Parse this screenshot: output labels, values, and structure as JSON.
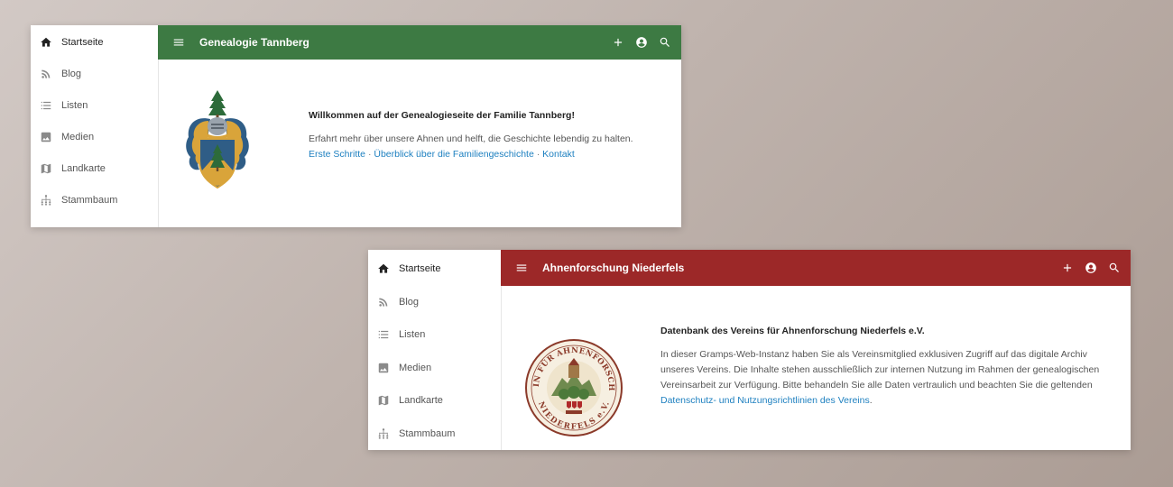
{
  "window1": {
    "accent_color": "#3d7a43",
    "title": "Genealogie Tannberg",
    "nav": [
      {
        "label": "Startseite",
        "icon": "home-icon"
      },
      {
        "label": "Blog",
        "icon": "rss-icon"
      },
      {
        "label": "Listen",
        "icon": "list-icon"
      },
      {
        "label": "Medien",
        "icon": "image-icon"
      },
      {
        "label": "Landkarte",
        "icon": "map-icon"
      },
      {
        "label": "Stammbaum",
        "icon": "family-tree-icon"
      }
    ],
    "heading": "Willkommen auf der Genealogieseite der Familie Tannberg!",
    "paragraph": "Erfahrt mehr über unsere Ahnen und helft, die Geschichte lebendig zu halten.",
    "links": [
      "Erste Schritte",
      "Überblick über die Familiengeschichte",
      "Kontakt"
    ],
    "link_separator": " · "
  },
  "window2": {
    "accent_color": "#9c2828",
    "title": "Ahnenforschung Niederfels",
    "nav": [
      {
        "label": "Startseite",
        "icon": "home-icon"
      },
      {
        "label": "Blog",
        "icon": "rss-icon"
      },
      {
        "label": "Listen",
        "icon": "list-icon"
      },
      {
        "label": "Medien",
        "icon": "image-icon"
      },
      {
        "label": "Landkarte",
        "icon": "map-icon"
      },
      {
        "label": "Stammbaum",
        "icon": "family-tree-icon"
      }
    ],
    "heading": "Datenbank des Vereins für Ahnenforschung Niederfels e.V.",
    "paragraph": "In dieser Gramps-Web-Instanz haben Sie als Vereinsmitglied exklusiven Zugriff auf das digitale Archiv unseres Vereins. Die Inhalte stehen ausschließlich zur internen Nutzung im Rahmen der genealogischen Vereinsarbeit zur Verfügung. Bitte behandeln Sie alle Daten vertraulich und beachten Sie die geltenden",
    "link": "Datenschutz- und Nutzungsrichtlinien des Vereins",
    "paragraph_end": ".",
    "seal_text_top": "VEREIN FÜR AHNENFORSCHUNG",
    "seal_text_bottom": "NIEDERFELS e.V."
  }
}
